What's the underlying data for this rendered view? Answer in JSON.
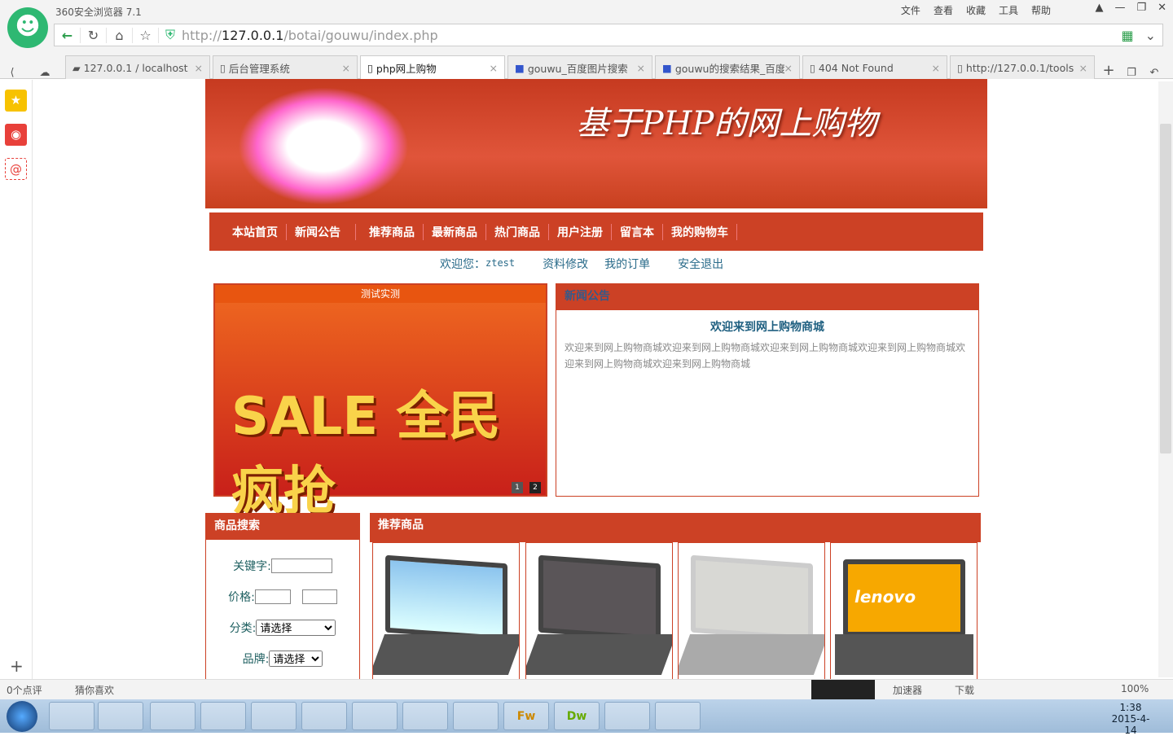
{
  "browser": {
    "title": "360安全浏览器 7.1",
    "menus": [
      "文件",
      "查看",
      "收藏",
      "工具",
      "帮助"
    ],
    "url_prefix": "http://",
    "url_host": "127.0.0.1",
    "url_path": "/botai/gouwu/index.php",
    "tabs": [
      {
        "label": "127.0.0.1 / localhost"
      },
      {
        "label": "后台管理系统"
      },
      {
        "label": "php网上购物",
        "active": true
      },
      {
        "label": "gouwu_百度图片搜索"
      },
      {
        "label": "gouwu的搜索结果_百度"
      },
      {
        "label": "404 Not Found"
      },
      {
        "label": "http://127.0.0.1/tools"
      }
    ],
    "status_left": [
      "0个点评",
      "猜你喜欢"
    ],
    "status_right": [
      "加速器",
      "下载"
    ],
    "zoom": "100%"
  },
  "page": {
    "banner_title": "基于PHP的网上购物",
    "nav": [
      "本站首页",
      "新闻公告",
      "推荐商品",
      "最新商品",
      "热门商品",
      "用户注册",
      "留言本",
      "我的购物车"
    ],
    "welcome": {
      "greeting": "欢迎您：",
      "user": "ztest",
      "links": [
        "资料修改",
        "我的订单",
        "安全退出"
      ]
    },
    "slider": {
      "caption": "测试实测",
      "image_text": "SALE 全民疯抢",
      "pages": [
        "1",
        "2"
      ]
    },
    "news": {
      "header": "新闻公告",
      "title": "欢迎来到网上购物商城",
      "body": "欢迎来到网上购物商城欢迎来到网上购物商城欢迎来到网上购物商城欢迎来到网上购物商城欢迎来到网上购物商城欢迎来到网上购物商城"
    },
    "search": {
      "header": "商品搜索",
      "keyword_label": "关键字:",
      "price_label": "价格:",
      "category_label": "分类:",
      "category_value": "请选择",
      "brand_label": "品牌:",
      "brand_value": "请选择"
    },
    "recommended": {
      "header": "推荐商品",
      "lenovo_text": "lenovo"
    }
  },
  "taskbar": {
    "time": "1:38",
    "date": "2015-4-14",
    "apps": [
      "Fw",
      "Dw"
    ]
  },
  "colors": {
    "brand_red": "#cc4125",
    "link": "#2a6b8a"
  }
}
